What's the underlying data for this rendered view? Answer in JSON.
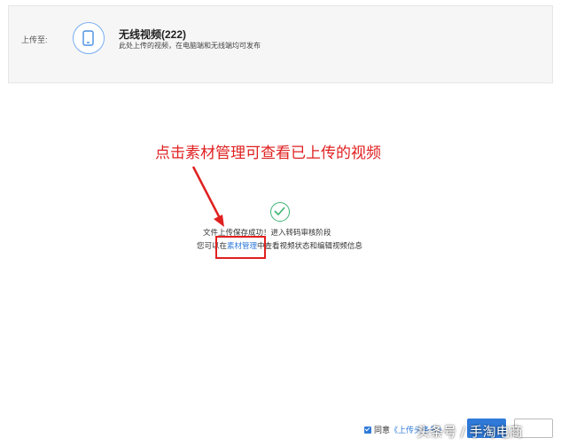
{
  "upload_target": {
    "label": "上传至:",
    "title": "无线视频(222)",
    "description": "此处上传的视频，在电脑端和无线端均可发布",
    "icon": "mobile-phone-icon"
  },
  "annotation": {
    "text": "点击素材管理可查看已上传的视频",
    "color": "#e02020"
  },
  "result": {
    "icon": "success-check-icon",
    "success_message": "文件上传保存成功！进入转码审核阶段",
    "manage_prefix": "您可以在",
    "manage_link": "素材管理",
    "manage_suffix": "中查看视频状态和编辑视频信息"
  },
  "footer": {
    "agree_label": "同意",
    "agree_link": "《上传头条号》",
    "accent_color": "#2f7ad9"
  },
  "watermark": "头条号 / 手淘电商"
}
